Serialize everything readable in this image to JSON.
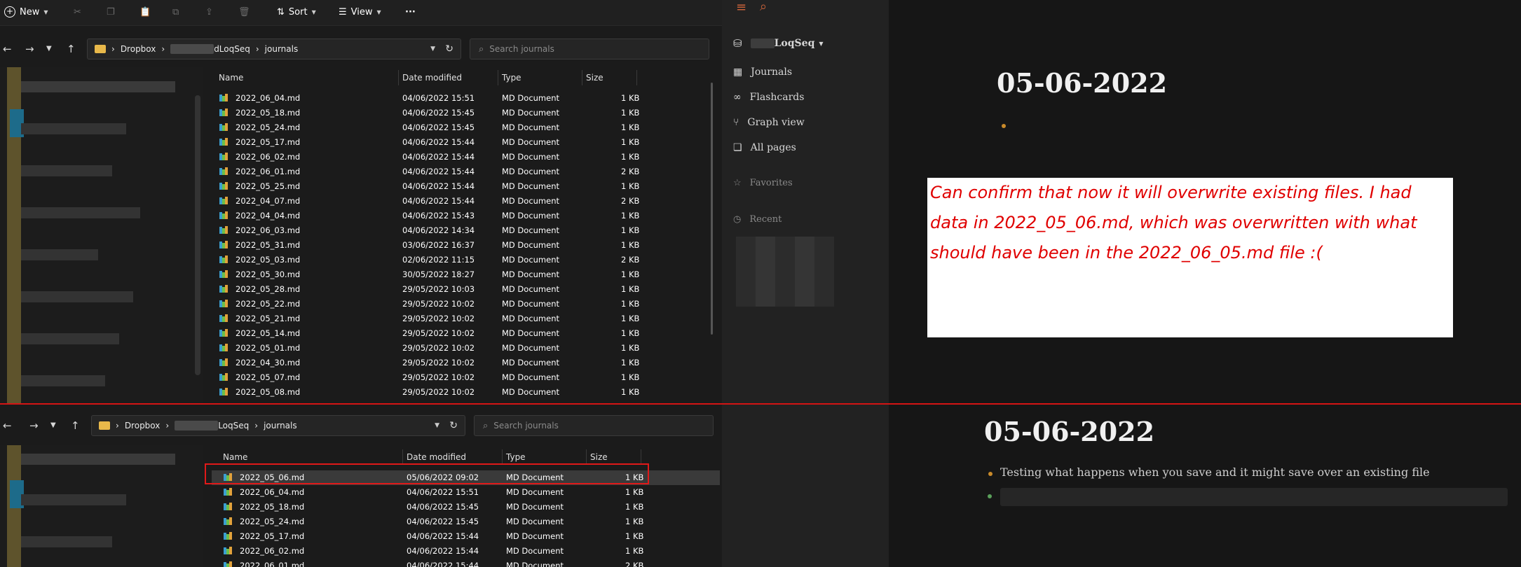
{
  "explorer_top": {
    "toolbar": {
      "new_label": "New",
      "sort_label": "Sort",
      "view_label": "View",
      "more_label": "···"
    },
    "address": {
      "crumbs": [
        "Dropbox",
        "dLoqSeq",
        "journals"
      ]
    },
    "search": {
      "placeholder": "Search journals"
    },
    "columns": [
      "Name",
      "Date modified",
      "Type",
      "Size"
    ],
    "rows": [
      [
        "2022_06_04.md",
        "04/06/2022 15:51",
        "MD Document",
        "1 KB"
      ],
      [
        "2022_05_18.md",
        "04/06/2022 15:45",
        "MD Document",
        "1 KB"
      ],
      [
        "2022_05_24.md",
        "04/06/2022 15:45",
        "MD Document",
        "1 KB"
      ],
      [
        "2022_05_17.md",
        "04/06/2022 15:44",
        "MD Document",
        "1 KB"
      ],
      [
        "2022_06_02.md",
        "04/06/2022 15:44",
        "MD Document",
        "1 KB"
      ],
      [
        "2022_06_01.md",
        "04/06/2022 15:44",
        "MD Document",
        "2 KB"
      ],
      [
        "2022_05_25.md",
        "04/06/2022 15:44",
        "MD Document",
        "1 KB"
      ],
      [
        "2022_04_07.md",
        "04/06/2022 15:44",
        "MD Document",
        "2 KB"
      ],
      [
        "2022_04_04.md",
        "04/06/2022 15:43",
        "MD Document",
        "1 KB"
      ],
      [
        "2022_06_03.md",
        "04/06/2022 14:34",
        "MD Document",
        "1 KB"
      ],
      [
        "2022_05_31.md",
        "03/06/2022 16:37",
        "MD Document",
        "1 KB"
      ],
      [
        "2022_05_03.md",
        "02/06/2022 11:15",
        "MD Document",
        "2 KB"
      ],
      [
        "2022_05_30.md",
        "30/05/2022 18:27",
        "MD Document",
        "1 KB"
      ],
      [
        "2022_05_28.md",
        "29/05/2022 10:03",
        "MD Document",
        "1 KB"
      ],
      [
        "2022_05_22.md",
        "29/05/2022 10:02",
        "MD Document",
        "1 KB"
      ],
      [
        "2022_05_21.md",
        "29/05/2022 10:02",
        "MD Document",
        "1 KB"
      ],
      [
        "2022_05_14.md",
        "29/05/2022 10:02",
        "MD Document",
        "1 KB"
      ],
      [
        "2022_05_01.md",
        "29/05/2022 10:02",
        "MD Document",
        "1 KB"
      ],
      [
        "2022_04_30.md",
        "29/05/2022 10:02",
        "MD Document",
        "1 KB"
      ],
      [
        "2022_05_07.md",
        "29/05/2022 10:02",
        "MD Document",
        "1 KB"
      ],
      [
        "2022_05_08.md",
        "29/05/2022 10:02",
        "MD Document",
        "1 KB"
      ]
    ]
  },
  "explorer_bottom": {
    "address": {
      "crumbs": [
        "Dropbox",
        "LoqSeq",
        "journals"
      ]
    },
    "search": {
      "placeholder": "Search journals"
    },
    "columns": [
      "Name",
      "Date modified",
      "Type",
      "Size"
    ],
    "rows": [
      [
        "2022_05_06.md",
        "05/06/2022 09:02",
        "MD Document",
        "1 KB"
      ],
      [
        "2022_06_04.md",
        "04/06/2022 15:51",
        "MD Document",
        "1 KB"
      ],
      [
        "2022_05_18.md",
        "04/06/2022 15:45",
        "MD Document",
        "1 KB"
      ],
      [
        "2022_05_24.md",
        "04/06/2022 15:45",
        "MD Document",
        "1 KB"
      ],
      [
        "2022_05_17.md",
        "04/06/2022 15:44",
        "MD Document",
        "1 KB"
      ],
      [
        "2022_06_02.md",
        "04/06/2022 15:44",
        "MD Document",
        "1 KB"
      ],
      [
        "2022_06_01.md",
        "04/06/2022 15:44",
        "MD Document",
        "2 KB"
      ]
    ]
  },
  "logseq": {
    "graph_name": "LoqSeq",
    "nav": [
      "Journals",
      "Flashcards",
      "Graph view",
      "All pages"
    ],
    "favorites_label": "Favorites",
    "recent_label": "Recent",
    "journal_title_top": "05-06-2022",
    "journal_title_bottom": "05-06-2022",
    "block_text": "Testing what happens when you save and it might save over an existing file"
  },
  "annotation": {
    "callout_text": "Can confirm that now it will overwrite existing files. I had data in 2022_05_06.md, which was overwritten with what should have been in the 2022_06_05.md file :(",
    "accent_color": "#e00000"
  }
}
